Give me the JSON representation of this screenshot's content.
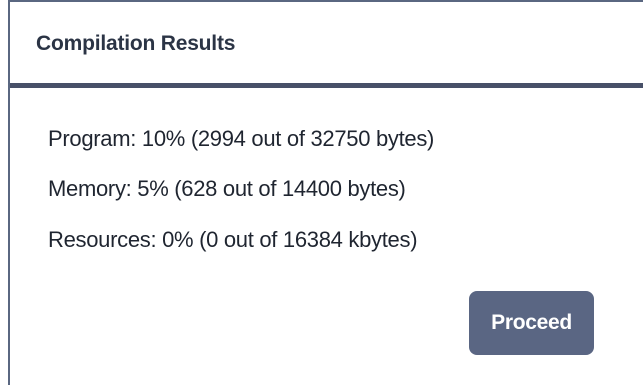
{
  "dialog": {
    "title": "Compilation Results",
    "lines": {
      "program": "Program: 10% (2994 out of 32750 bytes)",
      "memory": "Memory: 5% (628 out of 14400 bytes)",
      "resources": "Resources: 0% (0 out of 16384 kbytes)"
    },
    "proceed_label": "Proceed"
  },
  "colors": {
    "header_border": "#485068",
    "button_background": "#5a6683",
    "title_text": "#2b3445",
    "body_text": "#1f2530"
  }
}
